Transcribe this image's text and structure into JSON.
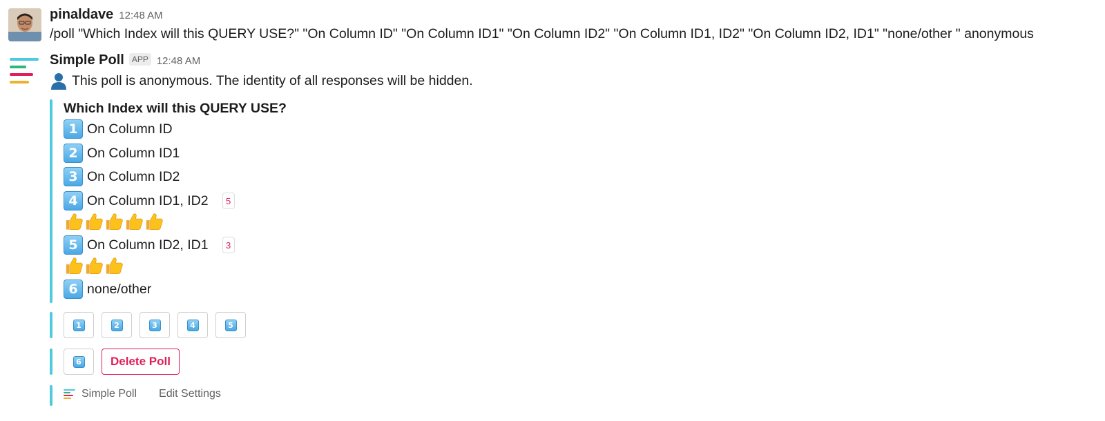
{
  "colors": {
    "accent_bar": "#4ec9e0",
    "danger": "#e01e5a",
    "keycap": "#4aa8e6"
  },
  "message1": {
    "author": "pinaldave",
    "time": "12:48 AM",
    "avatar": "user-avatar",
    "text": "/poll \"Which Index will this QUERY USE?\" \"On Column ID\" \"On Column ID1\" \"On Column ID2\" \"On Column ID1, ID2\" \"On Column ID2, ID1\" \"none/other \" anonymous"
  },
  "message2": {
    "author": "Simple Poll",
    "badge": "APP",
    "time": "12:48 AM",
    "anon_icon": "person-silhouette-icon",
    "anon_text": "This poll is anonymous. The identity of all responses will be hidden.",
    "poll": {
      "title": "Which Index will this QUERY USE?",
      "options": [
        {
          "key": "1",
          "label": "On Column ID",
          "count": "",
          "votes": 0
        },
        {
          "key": "2",
          "label": "On Column ID1",
          "count": "",
          "votes": 0
        },
        {
          "key": "3",
          "label": "On Column ID2",
          "count": "",
          "votes": 0
        },
        {
          "key": "4",
          "label": "On Column ID1, ID2",
          "count": "5",
          "votes": 5
        },
        {
          "key": "5",
          "label": "On Column ID2, ID1",
          "count": "3",
          "votes": 3
        },
        {
          "key": "6",
          "label": "none/other",
          "count": "",
          "votes": 0
        }
      ]
    },
    "buttons": {
      "vote": [
        "1",
        "2",
        "3",
        "4",
        "5",
        "6"
      ],
      "delete": "Delete Poll"
    },
    "footer": {
      "app_name": "Simple Poll",
      "edit": "Edit Settings"
    }
  }
}
